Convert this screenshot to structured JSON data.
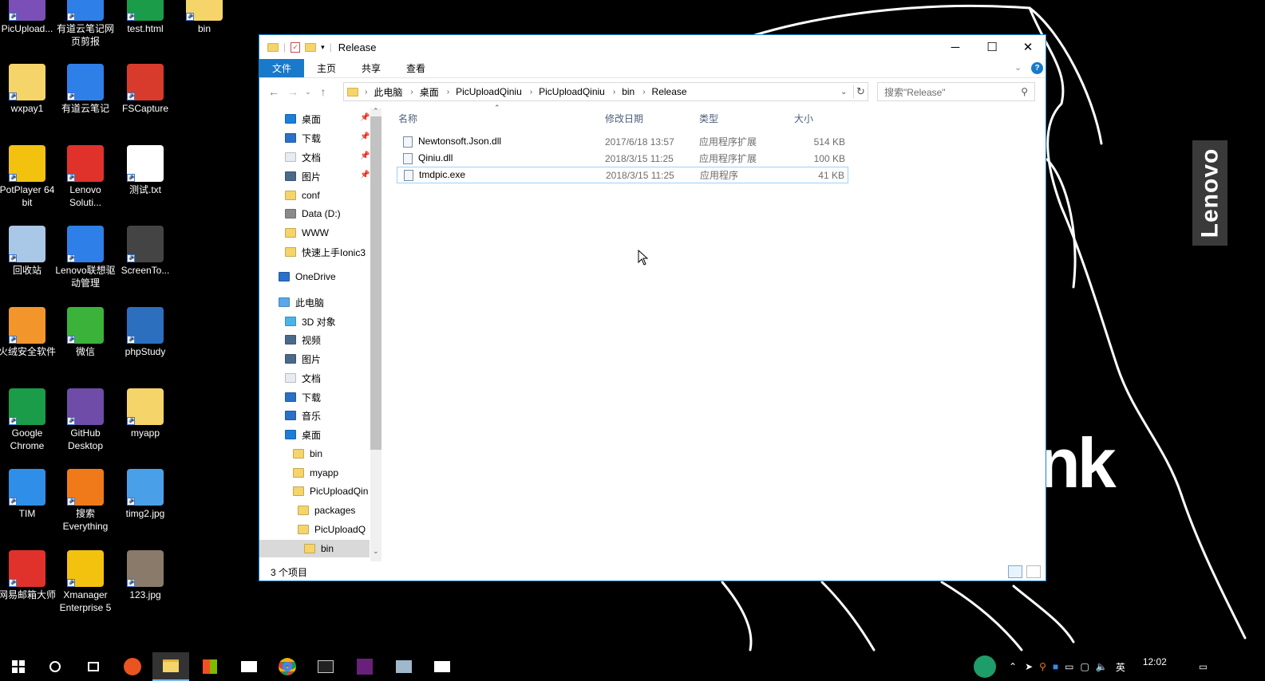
{
  "desktop": {
    "icons": [
      {
        "label": "PicUpload...",
        "color": "#7b4fb8"
      },
      {
        "label": "有道云笔记网页剪报",
        "color": "#2f7fe8"
      },
      {
        "label": "test.html",
        "color": "#1a9c48"
      },
      {
        "label": "bin",
        "color": "#f5d46a"
      },
      {
        "label": "wxpay1",
        "color": "#f5d46a"
      },
      {
        "label": "有道云笔记",
        "color": "#2f7fe8"
      },
      {
        "label": "FSCapture",
        "color": "#d83b2b"
      },
      {
        "label": "PotPlayer 64 bit",
        "color": "#f2c20f"
      },
      {
        "label": "Lenovo Soluti...",
        "color": "#e0322b"
      },
      {
        "label": "测试.txt",
        "color": "#ffffff"
      },
      {
        "label": "回收站",
        "color": "#a9c7e6"
      },
      {
        "label": "Lenovo联想驱动管理",
        "color": "#2f7fe8"
      },
      {
        "label": "ScreenTo...",
        "color": "#444444"
      },
      {
        "label": "火绒安全软件",
        "color": "#f2962b"
      },
      {
        "label": "微信",
        "color": "#3bb33b"
      },
      {
        "label": "phpStudy",
        "color": "#2c6fbf"
      },
      {
        "label": "Google Chrome",
        "color": "#1a9c48"
      },
      {
        "label": "GitHub Desktop",
        "color": "#6e4ca8"
      },
      {
        "label": "myapp",
        "color": "#f5d46a"
      },
      {
        "label": "TIM",
        "color": "#2f8fe8"
      },
      {
        "label": "搜索 Everything",
        "color": "#f07a1a"
      },
      {
        "label": "timg2.jpg",
        "color": "#4aa0e8"
      },
      {
        "label": "网易邮箱大师",
        "color": "#e0322b"
      },
      {
        "label": "Xmanager Enterprise 5",
        "color": "#f2c20f"
      },
      {
        "label": "123.jpg",
        "color": "#8a7a6a"
      }
    ],
    "wallpaper_brand": "Lenovo",
    "wallpaper_text": "nk"
  },
  "explorer": {
    "title": "Release",
    "ribbon_tabs": [
      "文件",
      "主页",
      "共享",
      "查看"
    ],
    "breadcrumb": [
      "此电脑",
      "桌面",
      "PicUploadQiniu",
      "PicUploadQiniu",
      "bin",
      "Release"
    ],
    "search_placeholder": "搜索\"Release\"",
    "nav_items": [
      {
        "label": "桌面",
        "color": "#1d7ed8"
      },
      {
        "label": "下载",
        "color": "#2a70c8"
      },
      {
        "label": "文档",
        "color": "#e8ecf2"
      },
      {
        "label": "图片",
        "color": "#4a6a8a"
      },
      {
        "label": "conf",
        "color": "#f5d46a"
      },
      {
        "label": "Data (D:)",
        "color": "#8a8a8a"
      },
      {
        "label": "WWW",
        "color": "#f5d46a"
      },
      {
        "label": "快速上手Ionic3",
        "color": "#f5d46a"
      },
      {
        "label": "OneDrive",
        "color": "#2a70c8"
      },
      {
        "label": "此电脑",
        "color": "#5aa8e8"
      },
      {
        "label": "3D 对象",
        "color": "#4ab4e8"
      },
      {
        "label": "视频",
        "color": "#4a6a8a"
      },
      {
        "label": "图片",
        "color": "#4a6a8a"
      },
      {
        "label": "文档",
        "color": "#e8ecf2"
      },
      {
        "label": "下载",
        "color": "#2a70c8"
      },
      {
        "label": "音乐",
        "color": "#2a70c8"
      },
      {
        "label": "桌面",
        "color": "#1d7ed8"
      },
      {
        "label": "bin",
        "color": "#f5d46a"
      },
      {
        "label": "myapp",
        "color": "#f5d46a"
      },
      {
        "label": "PicUploadQin",
        "color": "#f5d46a"
      },
      {
        "label": "packages",
        "color": "#f5d46a"
      },
      {
        "label": "PicUploadQ",
        "color": "#f5d46a"
      },
      {
        "label": "bin",
        "color": "#f5d46a"
      }
    ],
    "columns": [
      "名称",
      "修改日期",
      "类型",
      "大小"
    ],
    "files": [
      {
        "name": "Newtonsoft.Json.dll",
        "date": "2017/6/18 13:57",
        "type": "应用程序扩展",
        "size": "514 KB"
      },
      {
        "name": "Qiniu.dll",
        "date": "2018/3/15 11:25",
        "type": "应用程序扩展",
        "size": "100 KB"
      },
      {
        "name": "tmdpic.exe",
        "date": "2018/3/15 11:25",
        "type": "应用程序",
        "size": "41 KB"
      }
    ],
    "status": "3 个项目"
  },
  "taskbar": {
    "clock_time": "12:02",
    "ime_label": "英",
    "accent": "#76b9ed"
  }
}
